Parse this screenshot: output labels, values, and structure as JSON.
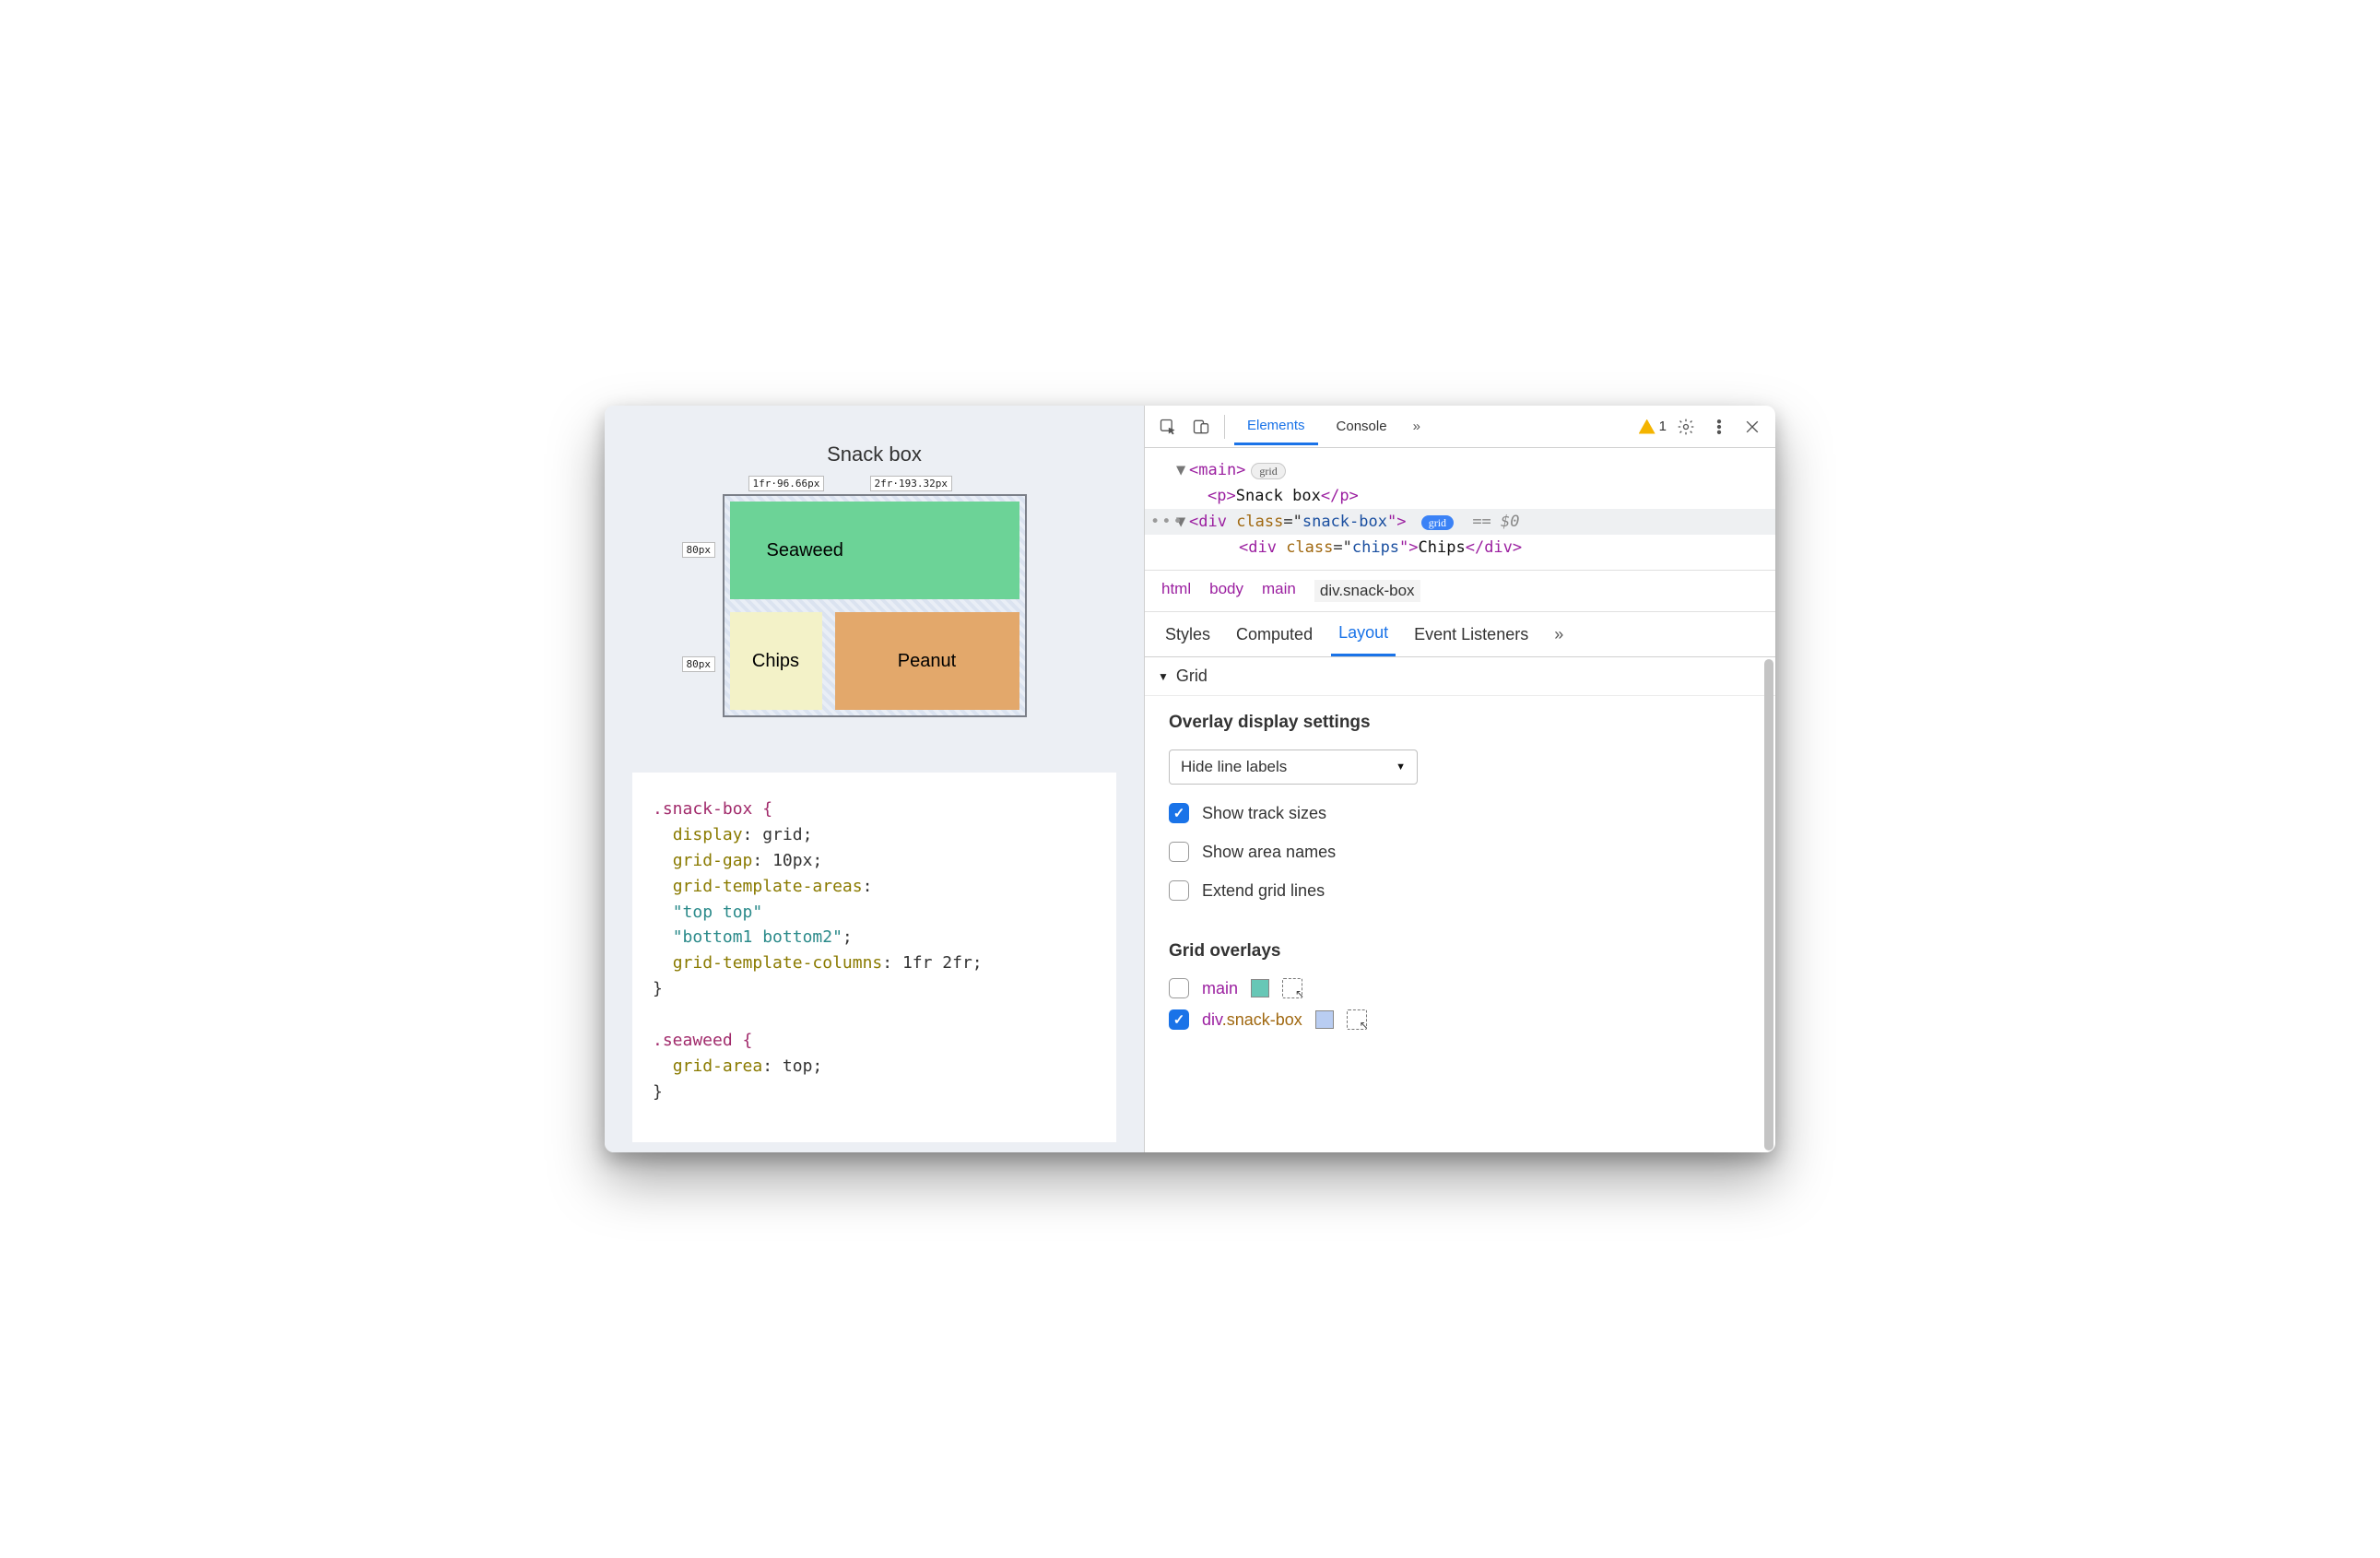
{
  "page": {
    "title": "Snack box",
    "tracks": {
      "col1": "1fr·96.66px",
      "col2": "2fr·193.32px",
      "row1": "80px",
      "row2": "80px"
    },
    "cells": {
      "seaweed": "Seaweed",
      "chips": "Chips",
      "peanut": "Peanut"
    },
    "css": {
      "sel1": ".snack-box {",
      "p_display_k": "display",
      "p_display_v": ": grid;",
      "p_gap_k": "grid-gap",
      "p_gap_v": ": 10px;",
      "p_areas_k": "grid-template-areas",
      "p_areas_v": ":",
      "area1": "\"top top\"",
      "area2": "\"bottom1 bottom2\"",
      "area2_tail": ";",
      "p_cols_k": "grid-template-columns",
      "p_cols_v": ": 1fr 2fr;",
      "close1": "}",
      "sel2": ".seaweed {",
      "p_ga_k": "grid-area",
      "p_ga_v": ": top;",
      "close2": "}"
    }
  },
  "toolbar": {
    "tab_elements": "Elements",
    "tab_console": "Console",
    "warn_count": "1"
  },
  "dom": {
    "l1_open": "<main>",
    "l1_pill": "grid",
    "l2": "<p>Snack box</p>",
    "l3_open": "<div class=\"snack-box\">",
    "l3_pill": "grid",
    "l3_tail": "== $0",
    "l4": "<div class=\"chips\">Chips</div>"
  },
  "breadcrumb": [
    "html",
    "body",
    "main",
    "div.snack-box"
  ],
  "subtabs": {
    "styles": "Styles",
    "computed": "Computed",
    "layout": "Layout",
    "events": "Event Listeners"
  },
  "grid_section": "Grid",
  "overlay_settings": {
    "heading": "Overlay display settings",
    "select_value": "Hide line labels",
    "opt_track": "Show track sizes",
    "opt_area": "Show area names",
    "opt_extend": "Extend grid lines"
  },
  "grid_overlays": {
    "heading": "Grid overlays",
    "items": [
      {
        "checked": false,
        "name_tag": "main",
        "name_cls": "",
        "color": "#67c7b6"
      },
      {
        "checked": true,
        "name_tag": "div",
        "name_cls": ".snack-box",
        "color": "#b9cdf2"
      }
    ]
  }
}
